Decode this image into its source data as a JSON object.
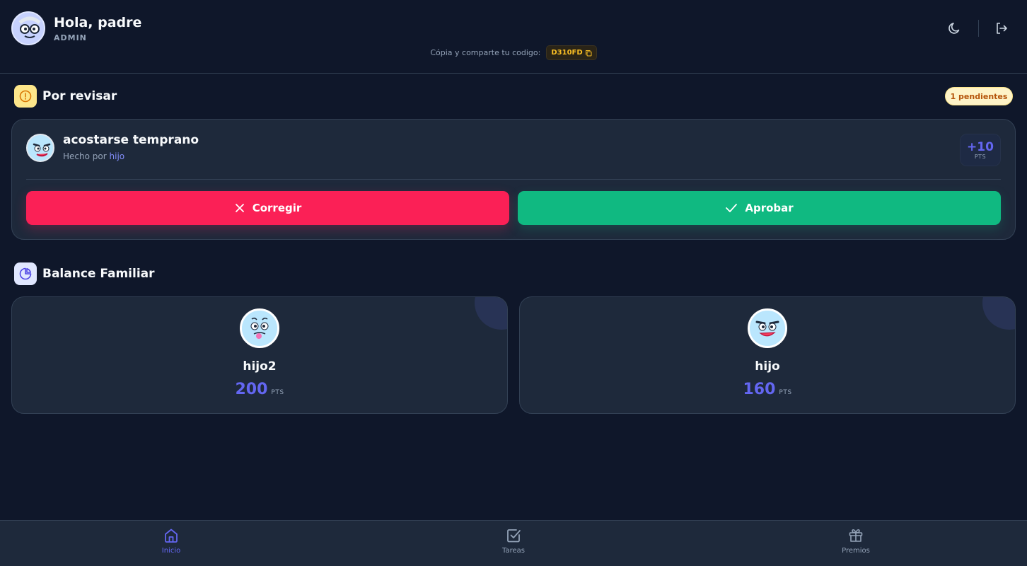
{
  "header": {
    "greeting": "Hola, padre",
    "role": "ADMIN",
    "share_text": "Cópia y comparte tu codigo:",
    "family_code": "D310FD",
    "theme_icon": "moon-icon",
    "logout_icon": "logout-icon"
  },
  "review": {
    "title": "Por revisar",
    "pending_badge": "1 pendientes",
    "task": {
      "name": "acostarse temprano",
      "done_by_prefix": "Hecho por",
      "done_by": "hijo",
      "points": "+10",
      "points_unit": "PTS"
    },
    "correct_label": "Corregir",
    "approve_label": "Aprobar"
  },
  "balance": {
    "title": "Balance Familiar",
    "kids": [
      {
        "name": "hijo2",
        "points": "200",
        "unit": "PTS"
      },
      {
        "name": "hijo",
        "points": "160",
        "unit": "PTS"
      }
    ]
  },
  "nav": {
    "items": [
      {
        "label": "Inicio",
        "icon": "home-icon",
        "active": true
      },
      {
        "label": "Tareas",
        "icon": "checkbox-icon",
        "active": false
      },
      {
        "label": "Premios",
        "icon": "gift-icon",
        "active": false
      }
    ]
  },
  "colors": {
    "background": "#0f172a",
    "card": "#1e293b",
    "accent": "#6366f1",
    "danger": "#fb2056",
    "success": "#10b981",
    "warning": "#fbbf24"
  }
}
